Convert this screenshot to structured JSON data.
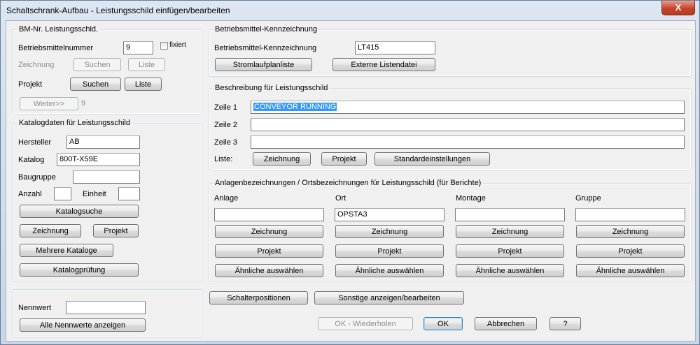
{
  "window": {
    "title": "Schaltschrank-Aufbau - Leistungsschild einfügen/bearbeiten",
    "close": "X"
  },
  "bm": {
    "group": "BM-Nr. Leistungsschld.",
    "betriebsmittelnummer_label": "Betriebsmittelnummer",
    "betriebsmittelnummer_value": "9",
    "fixiert": "fixiert",
    "zeichnung_label": "Zeichnung",
    "suchen": "Suchen",
    "liste": "Liste",
    "projekt_label": "Projekt",
    "weiter": "Weiter>>",
    "weiter_value": "9"
  },
  "katalog": {
    "group": "Katalogdaten für Leistungsschild",
    "hersteller_label": "Hersteller",
    "hersteller_value": "AB",
    "katalog_label": "Katalog",
    "katalog_value": "800T-X59E",
    "baugruppe_label": "Baugruppe",
    "baugruppe_value": "",
    "anzahl_label": "Anzahl",
    "anzahl_value": "",
    "einheit_label": "Einheit",
    "einheit_value": "",
    "katalogsuche": "Katalogsuche",
    "zeichnung": "Zeichnung",
    "projekt": "Projekt",
    "mehrere": "Mehrere Kataloge",
    "pruefung": "Katalogprüfung"
  },
  "nennwert": {
    "label": "Nennwert",
    "value": "",
    "alle": "Alle Nennwerte anzeigen"
  },
  "kenn": {
    "group": "Betriebsmittel-Kennzeichnung",
    "label": "Betriebsmittel-Kennzeichnung",
    "value": "LT415",
    "strom": "Stromlaufplanliste",
    "extern": "Externe Listendatei"
  },
  "beschreibung": {
    "group": "Beschreibung für Leistungsschild",
    "zeile1_label": "Zeile 1",
    "zeile1_value": "CONVEYOR RUNNING",
    "zeile2_label": "Zeile 2",
    "zeile2_value": "",
    "zeile3_label": "Zeile 3",
    "zeile3_value": "",
    "liste_label": "Liste:",
    "zeichnung": "Zeichnung",
    "projekt": "Projekt",
    "standard": "Standardeinstellungen"
  },
  "anlagen": {
    "group": "Anlagenbezeichnungen / Ortsbezeichnungen für Leistungsschild (für Berichte)",
    "columns": [
      {
        "label": "Anlage",
        "value": ""
      },
      {
        "label": "Ort",
        "value": "OPSTA3"
      },
      {
        "label": "Montage",
        "value": ""
      },
      {
        "label": "Gruppe",
        "value": ""
      }
    ],
    "zeichnung": "Zeichnung",
    "projekt": "Projekt",
    "aehnlich": "Ähnliche auswählen"
  },
  "bottom": {
    "schalter": "Schalterpositionen",
    "sonstige": "Sonstige anzeigen/bearbeiten",
    "ok_wiederholen": "OK - Wiederholen",
    "ok": "OK",
    "abbrechen": "Abbrechen",
    "help": "?"
  }
}
